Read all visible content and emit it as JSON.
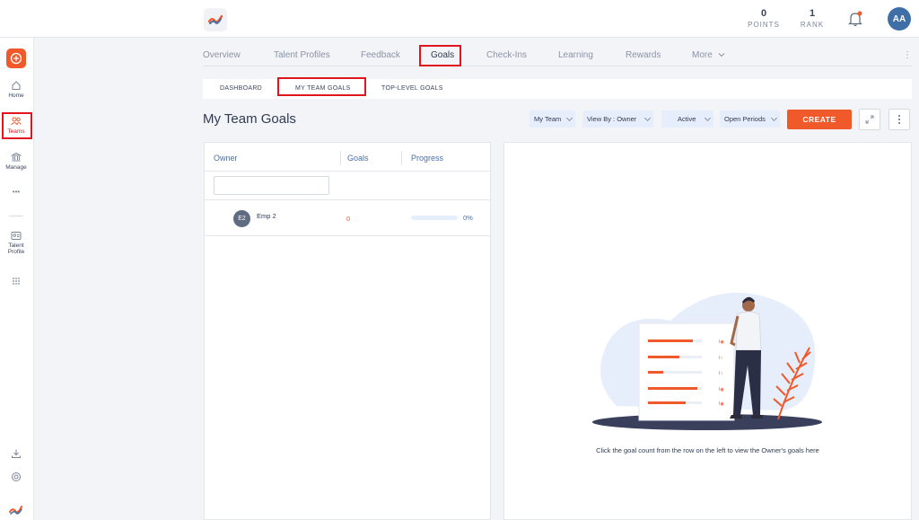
{
  "topbar": {
    "points_value": "0",
    "points_label": "POINTS",
    "rank_value": "1",
    "rank_label": "RANK",
    "avatar_initials": "AA"
  },
  "sidebar": {
    "items": [
      {
        "label": "Home",
        "icon": "home-icon"
      },
      {
        "label": "Teams",
        "icon": "teams-icon"
      },
      {
        "label": "Manage",
        "icon": "bank-icon"
      },
      {
        "label": "•••",
        "icon": "more-dots-icon"
      },
      {
        "label": "Talent Profile",
        "icon": "id-card-icon"
      },
      {
        "label": "",
        "icon": "grid-icon"
      }
    ],
    "active": "Teams"
  },
  "nav": {
    "tabs": [
      "Overview",
      "Talent Profiles",
      "Feedback",
      "Goals",
      "Check-Ins",
      "Learning",
      "Rewards",
      "More"
    ],
    "active": "Goals"
  },
  "subtabs": {
    "items": [
      "DASHBOARD",
      "MY TEAM GOALS",
      "TOP-LEVEL GOALS"
    ],
    "active": "MY TEAM GOALS"
  },
  "page": {
    "title": "My Team Goals",
    "filters": [
      "My Team",
      "View By : Owner",
      "Active",
      "Open Periods"
    ],
    "create_label": "CREATE"
  },
  "table": {
    "headers": [
      "Owner",
      "Goals",
      "Progress"
    ],
    "search_value": "",
    "rows": [
      {
        "initials": "E2",
        "name": "Emp 2",
        "goals": "0",
        "progress": 0,
        "progress_label": "0%"
      }
    ]
  },
  "detail": {
    "hint": "Click the goal count from the row on the left to view the Owner's goals here"
  },
  "colors": {
    "accent": "#f0592a",
    "link": "#4a6fa5",
    "highlight": "#e0161e"
  }
}
